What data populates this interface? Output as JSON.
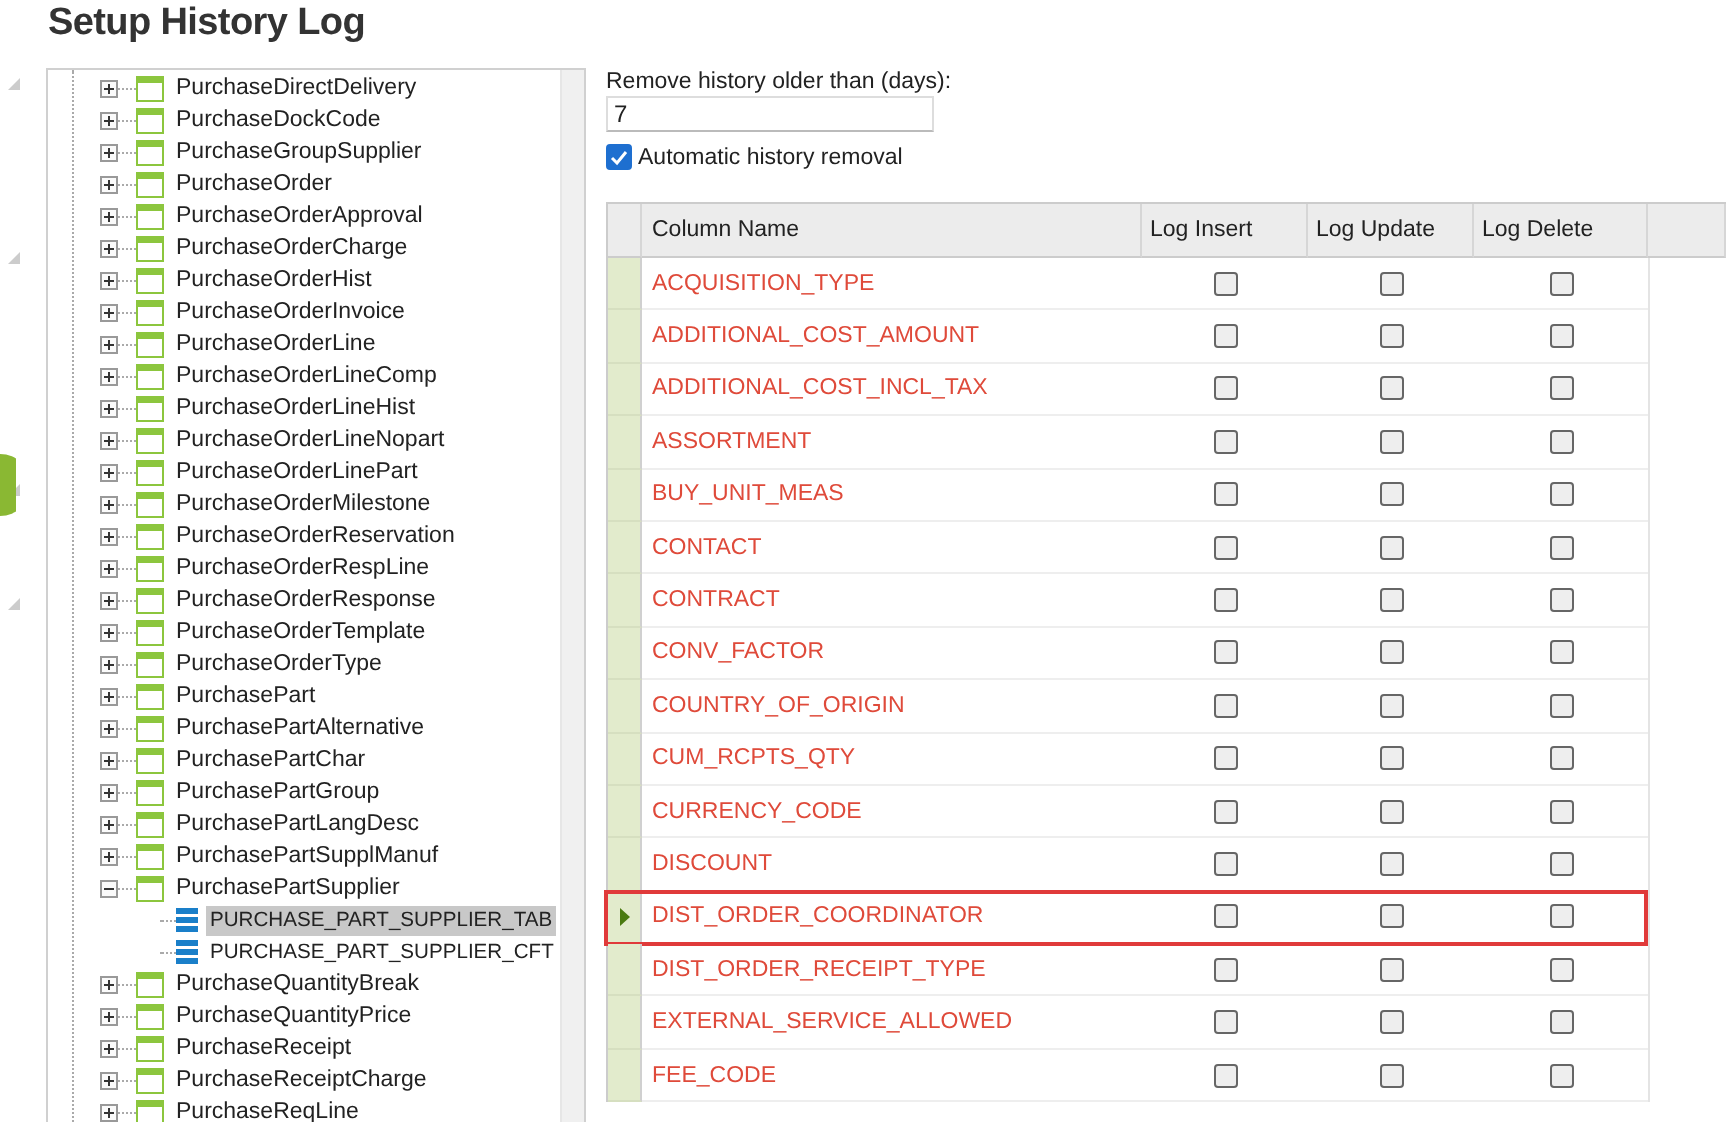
{
  "title": "Setup History Log",
  "tree": [
    {
      "label": "PurchaseDirectDelivery",
      "expanded": false
    },
    {
      "label": "PurchaseDockCode",
      "expanded": false
    },
    {
      "label": "PurchaseGroupSupplier",
      "expanded": false
    },
    {
      "label": "PurchaseOrder",
      "expanded": false
    },
    {
      "label": "PurchaseOrderApproval",
      "expanded": false
    },
    {
      "label": "PurchaseOrderCharge",
      "expanded": false
    },
    {
      "label": "PurchaseOrderHist",
      "expanded": false
    },
    {
      "label": "PurchaseOrderInvoice",
      "expanded": false
    },
    {
      "label": "PurchaseOrderLine",
      "expanded": false
    },
    {
      "label": "PurchaseOrderLineComp",
      "expanded": false
    },
    {
      "label": "PurchaseOrderLineHist",
      "expanded": false
    },
    {
      "label": "PurchaseOrderLineNopart",
      "expanded": false
    },
    {
      "label": "PurchaseOrderLinePart",
      "expanded": false
    },
    {
      "label": "PurchaseOrderMilestone",
      "expanded": false
    },
    {
      "label": "PurchaseOrderReservation",
      "expanded": false
    },
    {
      "label": "PurchaseOrderRespLine",
      "expanded": false
    },
    {
      "label": "PurchaseOrderResponse",
      "expanded": false
    },
    {
      "label": "PurchaseOrderTemplate",
      "expanded": false
    },
    {
      "label": "PurchaseOrderType",
      "expanded": false
    },
    {
      "label": "PurchasePart",
      "expanded": false
    },
    {
      "label": "PurchasePartAlternative",
      "expanded": false
    },
    {
      "label": "PurchasePartChar",
      "expanded": false
    },
    {
      "label": "PurchasePartGroup",
      "expanded": false
    },
    {
      "label": "PurchasePartLangDesc",
      "expanded": false
    },
    {
      "label": "PurchasePartSupplManuf",
      "expanded": false
    },
    {
      "label": "PurchasePartSupplier",
      "expanded": true,
      "children": [
        {
          "label": "PURCHASE_PART_SUPPLIER_TAB",
          "selected": true
        },
        {
          "label": "PURCHASE_PART_SUPPLIER_CFT",
          "selected": false
        }
      ]
    },
    {
      "label": "PurchaseQuantityBreak",
      "expanded": false
    },
    {
      "label": "PurchaseQuantityPrice",
      "expanded": false
    },
    {
      "label": "PurchaseReceipt",
      "expanded": false
    },
    {
      "label": "PurchaseReceiptCharge",
      "expanded": false
    },
    {
      "label": "PurchaseReqLine",
      "expanded": false
    }
  ],
  "days_field": {
    "label": "Remove history older than (days):",
    "value": "7"
  },
  "auto_removal": {
    "label": "Automatic history removal",
    "checked": true
  },
  "grid": {
    "columns": [
      "Column Name",
      "Log Insert",
      "Log Update",
      "Log Delete"
    ],
    "rows": [
      {
        "name": "ACQUISITION_TYPE",
        "insert": false,
        "update": false,
        "delete": false,
        "selected": false,
        "highlighted": false
      },
      {
        "name": "ADDITIONAL_COST_AMOUNT",
        "insert": false,
        "update": false,
        "delete": false,
        "selected": false,
        "highlighted": false
      },
      {
        "name": "ADDITIONAL_COST_INCL_TAX",
        "insert": false,
        "update": false,
        "delete": false,
        "selected": false,
        "highlighted": false
      },
      {
        "name": "ASSORTMENT",
        "insert": false,
        "update": false,
        "delete": false,
        "selected": false,
        "highlighted": false
      },
      {
        "name": "BUY_UNIT_MEAS",
        "insert": false,
        "update": false,
        "delete": false,
        "selected": false,
        "highlighted": false
      },
      {
        "name": "CONTACT",
        "insert": false,
        "update": false,
        "delete": false,
        "selected": false,
        "highlighted": false
      },
      {
        "name": "CONTRACT",
        "insert": false,
        "update": false,
        "delete": false,
        "selected": false,
        "highlighted": false
      },
      {
        "name": "CONV_FACTOR",
        "insert": false,
        "update": false,
        "delete": false,
        "selected": false,
        "highlighted": false
      },
      {
        "name": "COUNTRY_OF_ORIGIN",
        "insert": false,
        "update": false,
        "delete": false,
        "selected": false,
        "highlighted": false
      },
      {
        "name": "CUM_RCPTS_QTY",
        "insert": false,
        "update": false,
        "delete": false,
        "selected": false,
        "highlighted": false
      },
      {
        "name": "CURRENCY_CODE",
        "insert": false,
        "update": false,
        "delete": false,
        "selected": false,
        "highlighted": false
      },
      {
        "name": "DISCOUNT",
        "insert": false,
        "update": false,
        "delete": false,
        "selected": false,
        "highlighted": false
      },
      {
        "name": "DIST_ORDER_COORDINATOR",
        "insert": false,
        "update": false,
        "delete": false,
        "selected": true,
        "highlighted": true
      },
      {
        "name": "DIST_ORDER_RECEIPT_TYPE",
        "insert": false,
        "update": false,
        "delete": false,
        "selected": false,
        "highlighted": false
      },
      {
        "name": "EXTERNAL_SERVICE_ALLOWED",
        "insert": false,
        "update": false,
        "delete": false,
        "selected": false,
        "highlighted": false
      },
      {
        "name": "FEE_CODE",
        "insert": false,
        "update": false,
        "delete": false,
        "selected": false,
        "highlighted": false
      }
    ]
  }
}
